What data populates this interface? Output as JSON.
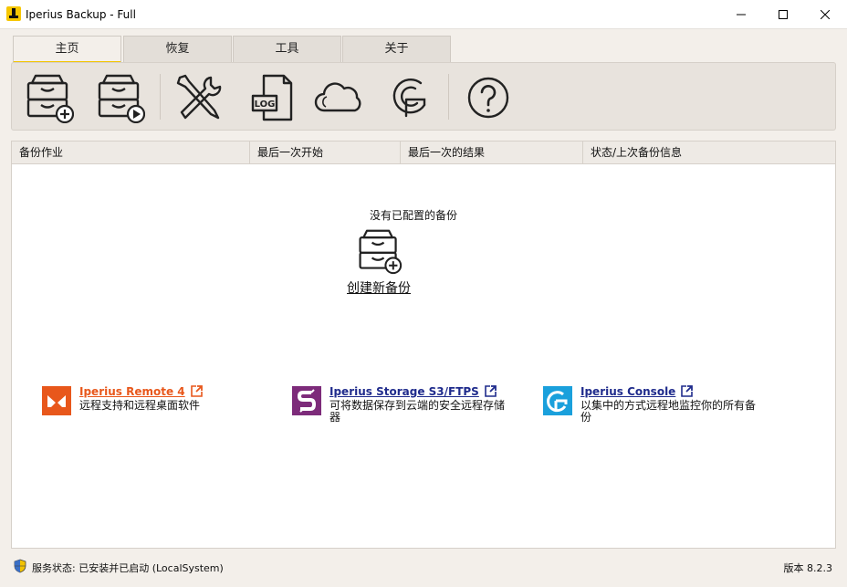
{
  "window": {
    "title": "Iperius Backup - Full"
  },
  "tabs": [
    {
      "label": "主页",
      "active": true
    },
    {
      "label": "恢复",
      "active": false
    },
    {
      "label": "工具",
      "active": false
    },
    {
      "label": "关于",
      "active": false
    }
  ],
  "toolbar": {
    "buttons": [
      {
        "icon": "new-backup-icon"
      },
      {
        "icon": "run-backup-icon"
      },
      {
        "icon": "tools-icon"
      },
      {
        "icon": "log-icon"
      },
      {
        "icon": "cloud-icon"
      },
      {
        "icon": "console-icon"
      },
      {
        "icon": "help-icon"
      }
    ]
  },
  "table": {
    "columns": [
      "备份作业",
      "最后一次开始",
      "最后一次的结果",
      "状态/上次备份信息"
    ],
    "empty_message": "没有已配置的备份",
    "create_link": "创建新备份"
  },
  "promos": [
    {
      "title": "Iperius Remote 4",
      "desc": "远程支持和远程桌面软件",
      "color": "#e8571b",
      "title_color": "#e8571b"
    },
    {
      "title": "Iperius Storage S3/FTPS",
      "desc": "可将数据保存到云端的安全远程存储器",
      "color": "#7d2b7a",
      "title_color": "#1f2b8c"
    },
    {
      "title": "Iperius Console",
      "desc": "以集中的方式远程地监控你的所有备份",
      "color": "#1aa0dc",
      "title_color": "#1f2b8c"
    }
  ],
  "status": {
    "text": "服务状态: 已安装并已启动 (LocalSystem)",
    "version": "版本 8.2.3"
  }
}
